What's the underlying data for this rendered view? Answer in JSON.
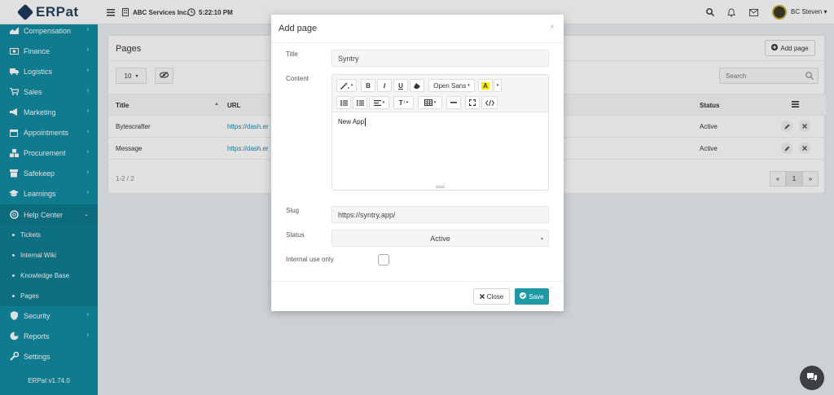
{
  "app": {
    "logo_text": "ERPat"
  },
  "topbar": {
    "company": "ABC Services Inc.",
    "time": "5:22:10 PM",
    "user_name": "BC Steven ▾"
  },
  "sidebar": {
    "items": [
      {
        "label": "Compensation",
        "icon": "compensation-icon"
      },
      {
        "label": "Finance",
        "icon": "money-icon"
      },
      {
        "label": "Logistics",
        "icon": "truck-icon"
      },
      {
        "label": "Sales",
        "icon": "cart-icon"
      },
      {
        "label": "Marketing",
        "icon": "bullhorn-icon"
      },
      {
        "label": "Appointments",
        "icon": "calendar-icon"
      },
      {
        "label": "Procurement",
        "icon": "cubes-icon"
      },
      {
        "label": "Safekeep",
        "icon": "archive-icon"
      },
      {
        "label": "Learnings",
        "icon": "graduation-icon"
      },
      {
        "label": "Help Center",
        "icon": "lifebuoy-icon"
      }
    ],
    "subitems": [
      "Tickets",
      "Internal Wiki",
      "Knowledge Base",
      "Pages"
    ],
    "bottom_items": [
      {
        "label": "Security",
        "icon": "shield-icon"
      },
      {
        "label": "Reports",
        "icon": "pie-chart-icon"
      },
      {
        "label": "Settings",
        "icon": "wrench-icon"
      }
    ],
    "version": "ERPat v1.74.0"
  },
  "page": {
    "title": "Pages",
    "add_button": "Add page",
    "page_size": "10",
    "search_placeholder": "Search",
    "columns": {
      "title": "Title",
      "url": "URL",
      "status": "Status"
    },
    "rows": [
      {
        "title": "Bytescrafter",
        "url": "https://dash.er",
        "status": "Active"
      },
      {
        "title": "Message",
        "url": "https://dash.er",
        "status": "Active"
      }
    ],
    "record_count": "1-2 / 2",
    "pagination": {
      "prev": "«",
      "current": "1",
      "next": "»"
    }
  },
  "modal": {
    "title": "Add page",
    "close_x": "×",
    "fields": {
      "title_label": "Title",
      "title_value": "Syntry",
      "content_label": "Content",
      "content_value": "New App",
      "slug_label": "Slug",
      "slug_value": "https://syntry.app/",
      "status_label": "Status",
      "status_value": "Active",
      "internal_label": "Internal use only"
    },
    "editor_toolbar": {
      "font_name": "Open Sans"
    },
    "buttons": {
      "close": "Close",
      "save": "Save"
    }
  },
  "colors": {
    "sidebar_bg": "#138da3",
    "accent": "#1d9aa8",
    "link": "#1c8aa8"
  }
}
